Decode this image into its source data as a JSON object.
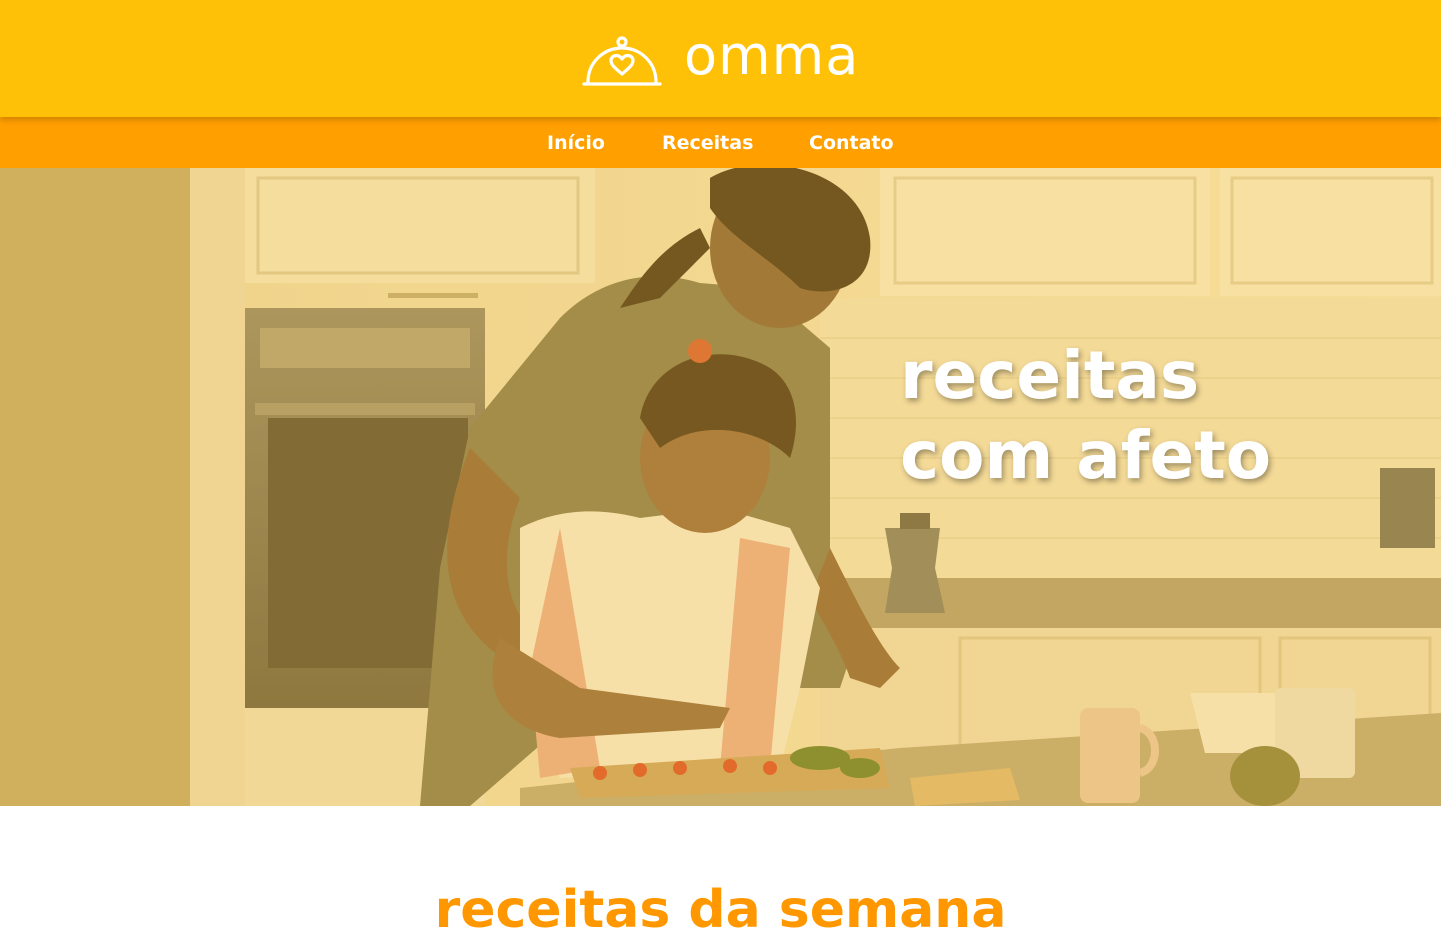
{
  "brand": {
    "name": "omma",
    "logo_icon": "cloche-heart-icon",
    "header_color": "#FFC107",
    "nav_color": "#FF9F00",
    "accent_color": "#FF9800"
  },
  "nav": {
    "items": [
      {
        "label": "Início"
      },
      {
        "label": "Receitas"
      },
      {
        "label": "Contato"
      }
    ]
  },
  "hero": {
    "title_line1": "receitas",
    "title_line2": "com afeto",
    "image": "mother-and-daughter-cooking-photo"
  },
  "section": {
    "title": "receitas da semana"
  }
}
